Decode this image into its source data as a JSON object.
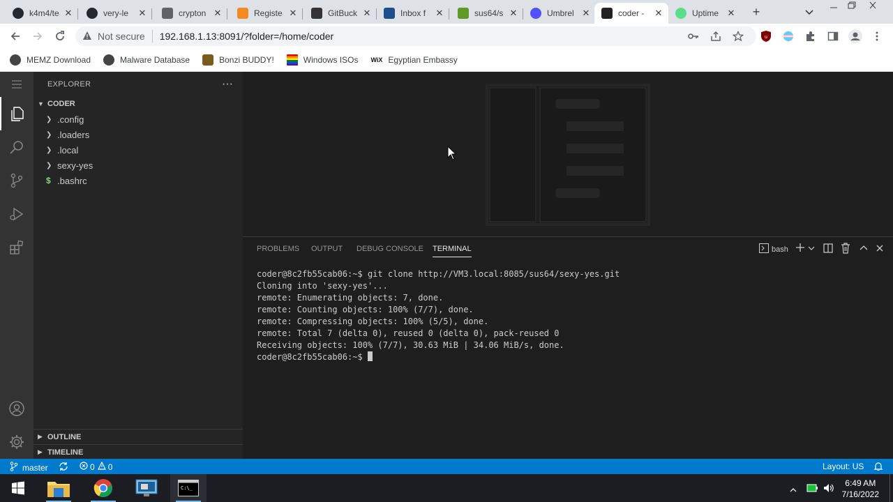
{
  "browser": {
    "tabs": [
      {
        "title": "k4m4/te",
        "icon": "github-icon",
        "color": "#24292f"
      },
      {
        "title": "very-le",
        "icon": "github-icon",
        "color": "#24292f"
      },
      {
        "title": "crypton",
        "icon": "globe-icon",
        "color": "#5f6368"
      },
      {
        "title": "Registe",
        "icon": "diamond-icon",
        "color": "#f28b25"
      },
      {
        "title": "GitBuck",
        "icon": "gitbucket-icon",
        "color": "#333333"
      },
      {
        "title": "Inbox f",
        "icon": "mail-icon",
        "color": "#1f4e8c"
      },
      {
        "title": "sus64/s",
        "icon": "gitea-icon",
        "color": "#609926"
      },
      {
        "title": "Umbrel",
        "icon": "umbrel-icon",
        "color": "#5351fb"
      },
      {
        "title": "coder -",
        "icon": "vscode-icon",
        "color": "#222222"
      },
      {
        "title": "Uptime",
        "icon": "uptime-icon",
        "color": "#5cdd8b"
      }
    ],
    "not_secure": "Not secure",
    "url": "192.168.1.13:8091/?folder=/home/coder",
    "bookmarks": [
      {
        "label": "MEMZ Download",
        "color": "#444444"
      },
      {
        "label": "Malware Database",
        "color": "#444444"
      },
      {
        "label": "Bonzi BUDDY!",
        "color": "#7b5a1e"
      },
      {
        "label": "Windows ISOs",
        "color": "#e81123"
      },
      {
        "label": "Egyptian Embassy",
        "color": "#111111"
      }
    ],
    "wix_label": "WiX"
  },
  "explorer": {
    "title": "EXPLORER",
    "root": "CODER",
    "items": [
      {
        "name": ".config",
        "type": "folder"
      },
      {
        "name": ".loaders",
        "type": "folder"
      },
      {
        "name": ".local",
        "type": "folder"
      },
      {
        "name": "sexy-yes",
        "type": "folder"
      },
      {
        "name": ".bashrc",
        "type": "file"
      }
    ],
    "outline": "OUTLINE",
    "timeline": "TIMELINE"
  },
  "panel": {
    "tabs": [
      "PROBLEMS",
      "OUTPUT",
      "DEBUG CONSOLE",
      "TERMINAL"
    ],
    "active_tab": "TERMINAL",
    "shell": "bash",
    "terminal_lines": [
      "coder@8c2fb55cab06:~$ git clone http://VM3.local:8085/sus64/sexy-yes.git",
      "Cloning into 'sexy-yes'...",
      "remote: Enumerating objects: 7, done.",
      "remote: Counting objects: 100% (7/7), done.",
      "remote: Compressing objects: 100% (5/5), done.",
      "remote: Total 7 (delta 0), reused 0 (delta 0), pack-reused 0",
      "Receiving objects: 100% (7/7), 30.63 MiB | 34.06 MiB/s, done."
    ],
    "prompt": "coder@8c2fb55cab06:~$ "
  },
  "statusbar": {
    "branch": "master",
    "errors": "0",
    "warnings": "0",
    "layout": "Layout: US"
  },
  "taskbar": {
    "time": "6:49 AM",
    "date": "7/16/2022"
  }
}
